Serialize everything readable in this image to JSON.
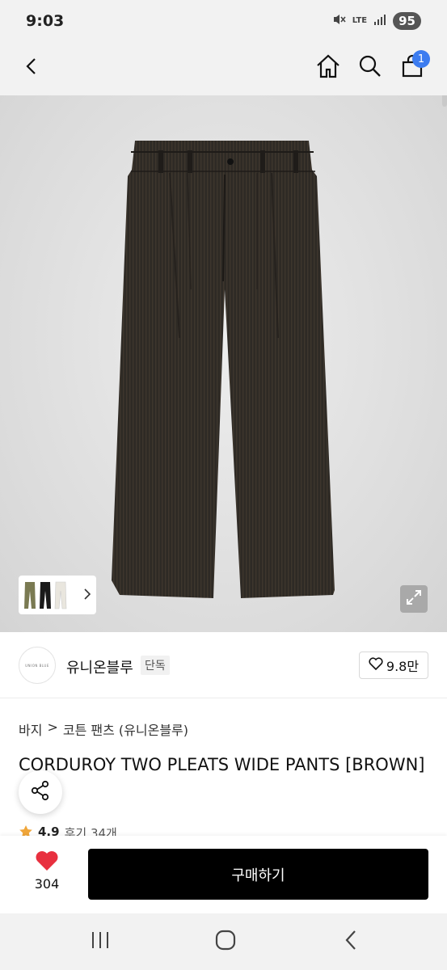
{
  "status": {
    "time": "9:03",
    "network": "LTE",
    "battery": "95"
  },
  "header": {
    "cart_count": "1"
  },
  "brand": {
    "logo_text": "UNION BLUE",
    "name": "유니온블루",
    "tag": "단독",
    "likes": "9.8만"
  },
  "breadcrumb": {
    "category": "바지",
    "separator": ">",
    "subcategory": "코튼 팬츠 (유니온블루)"
  },
  "product": {
    "title": "CORDUROY TWO PLEATS WIDE PANTS [BROWN]"
  },
  "rating": {
    "score": "4.9",
    "reviews": "후기 34개"
  },
  "buy_bar": {
    "fav_count": "304",
    "buy_label": "구매하기"
  },
  "colors": {
    "accent": "#3c7cf0",
    "heart": "#e8303f",
    "buy_button": "#000000",
    "star": "#f0a63a"
  }
}
